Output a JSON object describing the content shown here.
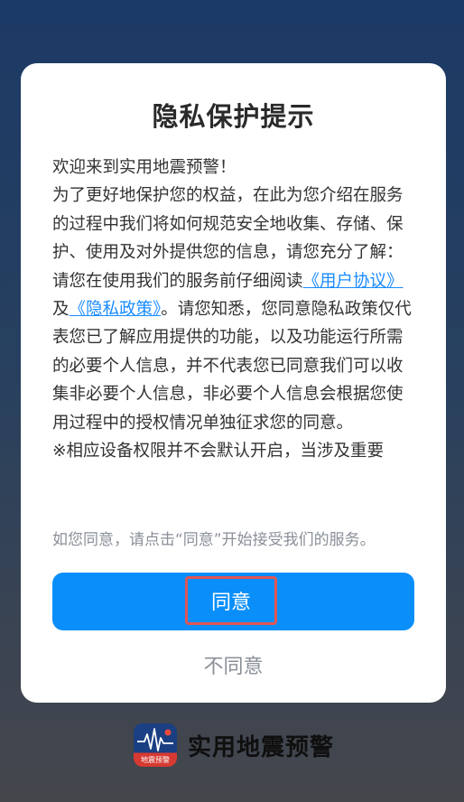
{
  "dialog": {
    "title": "隐私保护提示",
    "welcome": "欢迎来到实用地震预警！",
    "paragraph1": "为了更好地保护您的权益，在此为您介绍在服务的过程中我们将如何规范安全地收集、存储、保护、使用及对外提供您的信息，请您充分了解：",
    "p2_prefix": "请您在使用我们的服务前仔细阅读",
    "user_agreement_link": "《用户协议》",
    "and": "及",
    "privacy_policy_link": "《隐私政策》",
    "p2_suffix": "。请您知悉，您同意隐私政策仅代表您已了解应用提供的功能，以及功能运行所需的必要个人信息，并不代表您已同意我们可以收集非必要个人信息，非必要个人信息会根据您使用过程中的授权情况单独征求您的同意。",
    "paragraph3": "※相应设备权限并不会默认开启，当涉及重要",
    "agree_hint": "如您同意，请点击“同意”开始接受我们的服务。",
    "agree_label": "同意",
    "disagree_label": "不同意"
  },
  "footer": {
    "app_name": "实用地震预警",
    "icon_text": "地震预警",
    "icon": "seismograph-icon"
  },
  "colors": {
    "accent": "#0a8ffa",
    "link": "#1a8cff",
    "highlight_border": "#e05555"
  }
}
